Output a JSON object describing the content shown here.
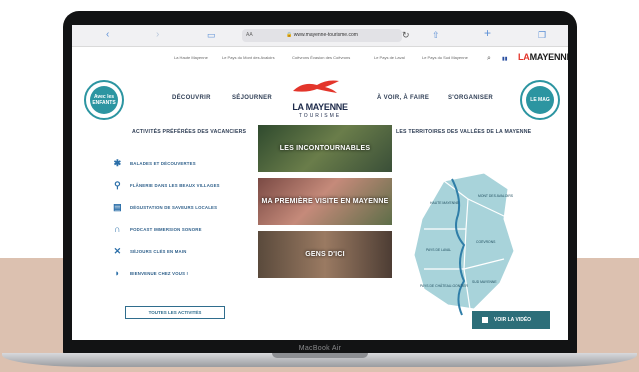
{
  "browser": {
    "url": "www.mayenne-tourisme.com",
    "reader_label": "AA"
  },
  "topnav": {
    "links": [
      "La Haute Mayenne",
      "Le Pays du Mont des Avaloirs",
      "Coëvrons Évasion des Coëvrons",
      "Le Pays de Laval",
      "Le Pays du Sud Mayenne"
    ],
    "brand_prefix": "LA",
    "brand_main": "MAYENNE"
  },
  "header": {
    "logo_title": "LA MAYENNE",
    "logo_subtitle": "TOURISME",
    "nav": [
      "DÉCOUVRIR",
      "SÉJOURNER",
      "À VOIR, À FAIRE",
      "S'ORGANISER"
    ],
    "left_badge": "Avec les ENFANTS",
    "right_badge": "LE MAG"
  },
  "activities": {
    "title": "ACTIVITÉS PRÉFÉRÉES DES VACANCIERS",
    "items": [
      {
        "label": "BALADES ET DÉCOUVERTES",
        "icon": "hiking-icon"
      },
      {
        "label": "FLÂNERIE DANS LES BEAUX VILLAGES",
        "icon": "bicycle-icon"
      },
      {
        "label": "DÉGUSTATION DE SAVEURS LOCALES",
        "icon": "menu-card-icon"
      },
      {
        "label": "PODCAST IMMERSION SONORE",
        "icon": "headphones-icon"
      },
      {
        "label": "SÉJOURS CLÉS EN MAIN",
        "icon": "compass-icon"
      },
      {
        "label": "BIENVENUE CHEZ VOUS !",
        "icon": "leaf-icon"
      }
    ],
    "all_button": "TOUTES LES ACTIVITÉS"
  },
  "tiles": [
    {
      "label": "LES INCONTOURNABLES",
      "color": "#3f5a3a"
    },
    {
      "label": "MA PREMIÈRE VISITE EN MAYENNE",
      "color": "#8a5a4e"
    },
    {
      "label": "GENS D'ICI",
      "color": "#6a5a4a"
    }
  ],
  "territories": {
    "title": "LES TERRITOIRES DES VALLÉES DE LA MAYENNE",
    "regions": [
      "HAUTE MAYENNE",
      "MONT DES AVALOIRS",
      "PAYS DE LAVAL",
      "COËVRONS",
      "PAYS DE CHÂTEAU-GONTIER",
      "SUD MAYENNE"
    ],
    "map_color": "#a8d3da",
    "river_color": "#2f7ea8"
  },
  "video_button": "VOIR LA VIDÉO",
  "device_label": "MacBook Air"
}
